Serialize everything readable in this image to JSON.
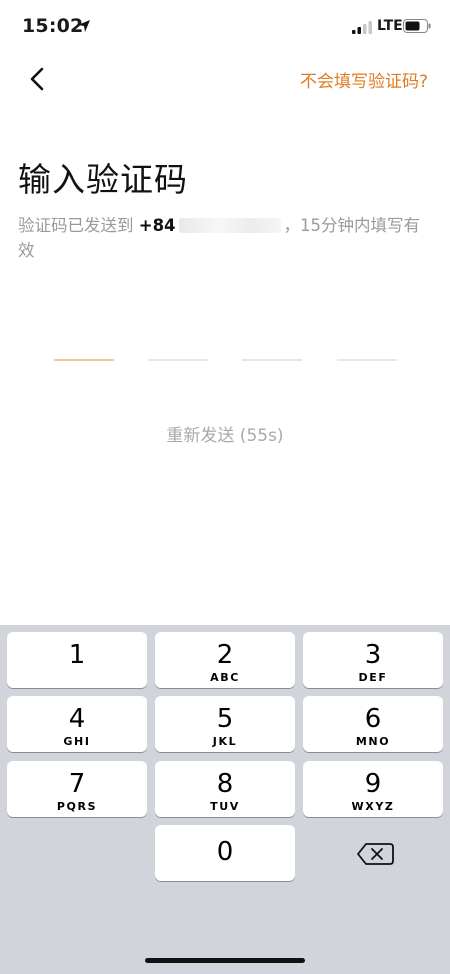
{
  "status_bar": {
    "time": "15:02",
    "network": "LTE"
  },
  "nav": {
    "help_link": "不会填写验证码?"
  },
  "title": "输入验证码",
  "subtitle": {
    "before": "验证码已发送到 ",
    "phone": "+84",
    "after": "，15分钟内填写有效"
  },
  "code_slots": 4,
  "resend": "重新发送 (55s)",
  "keyboard": {
    "keys": [
      {
        "digit": "1",
        "letters": ""
      },
      {
        "digit": "2",
        "letters": "ABC"
      },
      {
        "digit": "3",
        "letters": "DEF"
      },
      {
        "digit": "4",
        "letters": "GHI"
      },
      {
        "digit": "5",
        "letters": "JKL"
      },
      {
        "digit": "6",
        "letters": "MNO"
      },
      {
        "digit": "7",
        "letters": "PQRS"
      },
      {
        "digit": "8",
        "letters": "TUV"
      },
      {
        "digit": "9",
        "letters": "WXYZ"
      },
      {
        "digit": "0",
        "letters": ""
      }
    ]
  },
  "colors": {
    "accent": "#e07b22",
    "keyboard_bg": "#d1d4da"
  },
  "icons": [
    "location-arrow-icon",
    "signal-icon",
    "battery-icon",
    "back-chevron-icon",
    "delete-key-icon"
  ]
}
